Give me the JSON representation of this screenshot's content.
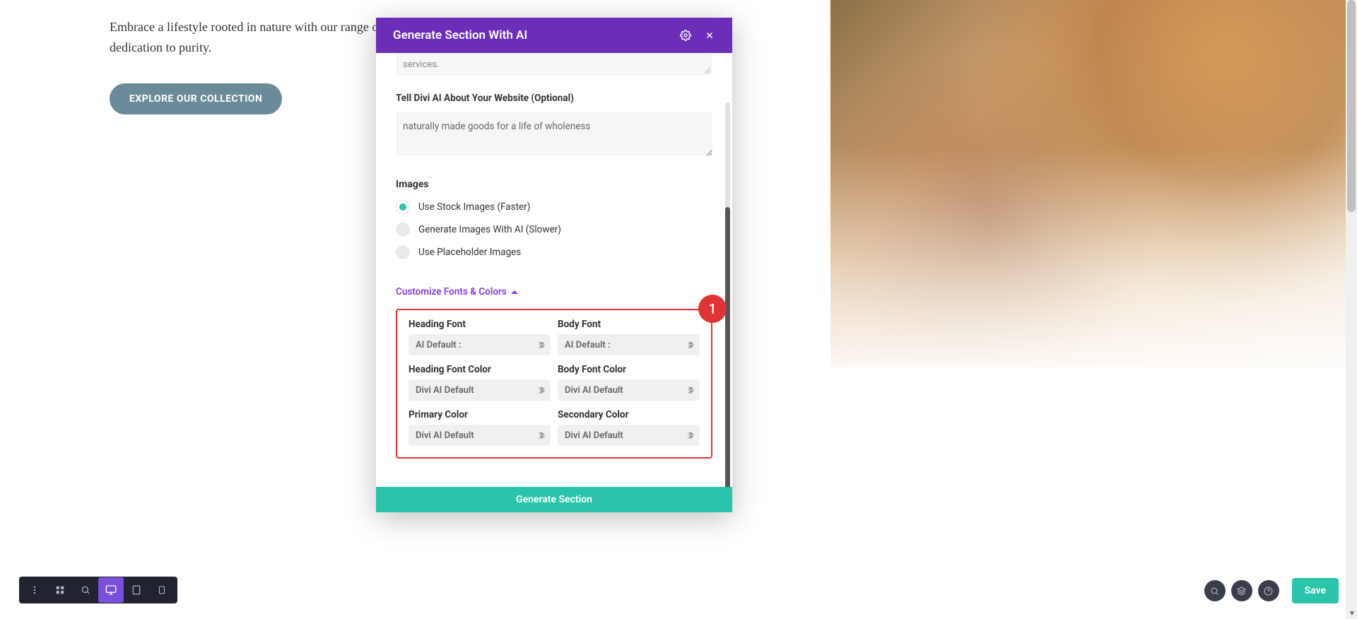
{
  "hero": {
    "text": "Embrace a lifestyle rooted in nature with our range of ... with care and dedication to purity.",
    "button": "EXPLORE OUR COLLECTION"
  },
  "modal": {
    "title": "Generate Section With AI",
    "stub_text": "services.",
    "website_label": "Tell Divi AI About Your Website (Optional)",
    "website_value": "naturally made goods for a life of wholeness",
    "images_label": "Images",
    "radio_stock": "Use Stock Images (Faster)",
    "radio_ai": "Generate Images With AI (Slower)",
    "radio_placeholder": "Use Placeholder Images",
    "customize_label": "Customize Fonts & Colors",
    "badge": "1",
    "fields": {
      "heading_font_label": "Heading Font",
      "heading_font_value": "AI Default :",
      "body_font_label": "Body Font",
      "body_font_value": "AI Default :",
      "heading_color_label": "Heading Font Color",
      "heading_color_value": "Divi AI Default",
      "body_color_label": "Body Font Color",
      "body_color_value": "Divi AI Default",
      "primary_color_label": "Primary Color",
      "primary_color_value": "Divi AI Default",
      "secondary_color_label": "Secondary Color",
      "secondary_color_value": "Divi AI Default"
    },
    "footer_button": "Generate Section"
  },
  "bottombar": {
    "save": "Save"
  }
}
